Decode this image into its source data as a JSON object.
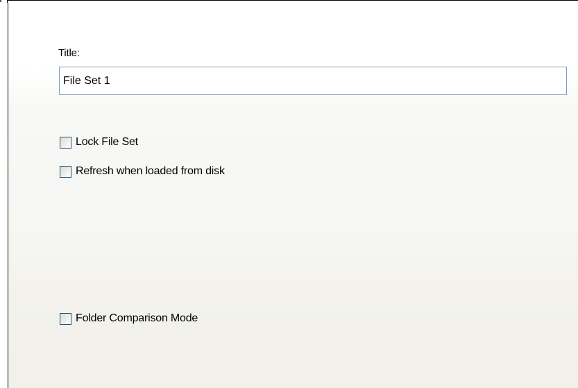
{
  "form": {
    "title_label": "Title:",
    "title_value": "File Set 1",
    "checkboxes": {
      "lock_file_set": {
        "label": "Lock File Set",
        "checked": false
      },
      "refresh_on_load": {
        "label": "Refresh when loaded from disk",
        "checked": false
      },
      "folder_comparison": {
        "label": "Folder Comparison Mode",
        "checked": false
      }
    }
  },
  "colors": {
    "input_border": "#7f9db9",
    "checkbox_border": "#1c5180",
    "panel_bottom": "#f1f0ea"
  }
}
